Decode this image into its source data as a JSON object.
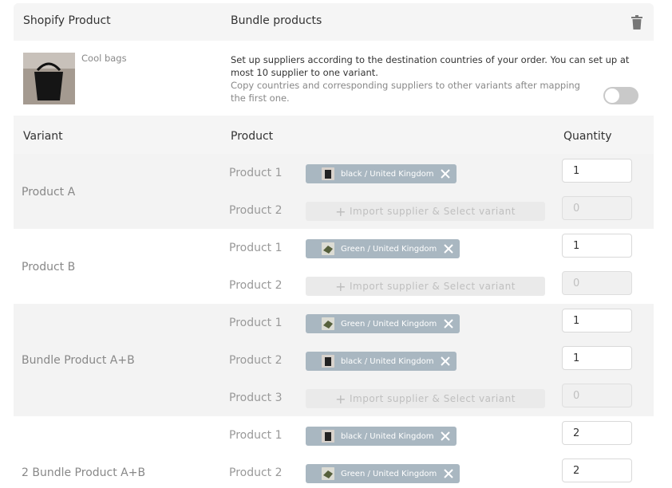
{
  "header": {
    "shopify_product_label": "Shopify Product",
    "bundle_products_label": "Bundle products"
  },
  "product": {
    "name": "Cool bags",
    "note_primary": "Set up suppliers according to the destination countries of your order. You can set up at most 10 supplier to one variant.",
    "note_secondary": "Copy countries and corresponding suppliers to other variants after mapping the first one.",
    "copy_toggle_on": false
  },
  "table": {
    "headers": {
      "variant": "Variant",
      "product": "Product",
      "quantity": "Quantity"
    },
    "import_placeholder": "Import supplier & Select variant",
    "variants": [
      {
        "name": "Product A",
        "rows": [
          {
            "label": "Product 1",
            "chip": "black / United Kingdom",
            "chip_icon": "black-bag-thumb",
            "qty": "1",
            "disabled": false
          },
          {
            "label": "Product 2",
            "chip": null,
            "qty": "0",
            "disabled": true
          }
        ]
      },
      {
        "name": "Product B",
        "rows": [
          {
            "label": "Product 1",
            "chip": "Green / United Kingdom",
            "chip_icon": "green-bag-thumb",
            "qty": "1",
            "disabled": false
          },
          {
            "label": "Product 2",
            "chip": null,
            "qty": "0",
            "disabled": true
          }
        ]
      },
      {
        "name": "Bundle Product A+B",
        "rows": [
          {
            "label": "Product 1",
            "chip": "Green / United Kingdom",
            "chip_icon": "green-bag-thumb",
            "qty": "1",
            "disabled": false
          },
          {
            "label": "Product 2",
            "chip": "black / United Kingdom",
            "chip_icon": "black-bag-thumb",
            "qty": "1",
            "disabled": false
          },
          {
            "label": "Product 3",
            "chip": null,
            "qty": "0",
            "disabled": true
          }
        ]
      },
      {
        "name": "2 Bundle Product A+B",
        "rows": [
          {
            "label": "Product 1",
            "chip": "black / United Kingdom",
            "chip_icon": "black-bag-thumb",
            "qty": "2",
            "disabled": false
          },
          {
            "label": "Product 2",
            "chip": "Green / United Kingdom",
            "chip_icon": "green-bag-thumb",
            "qty": "2",
            "disabled": false
          }
        ]
      }
    ]
  },
  "colors": {
    "chip_bg": "#a9b7c1",
    "panel_bg": "#f5f5f5"
  }
}
